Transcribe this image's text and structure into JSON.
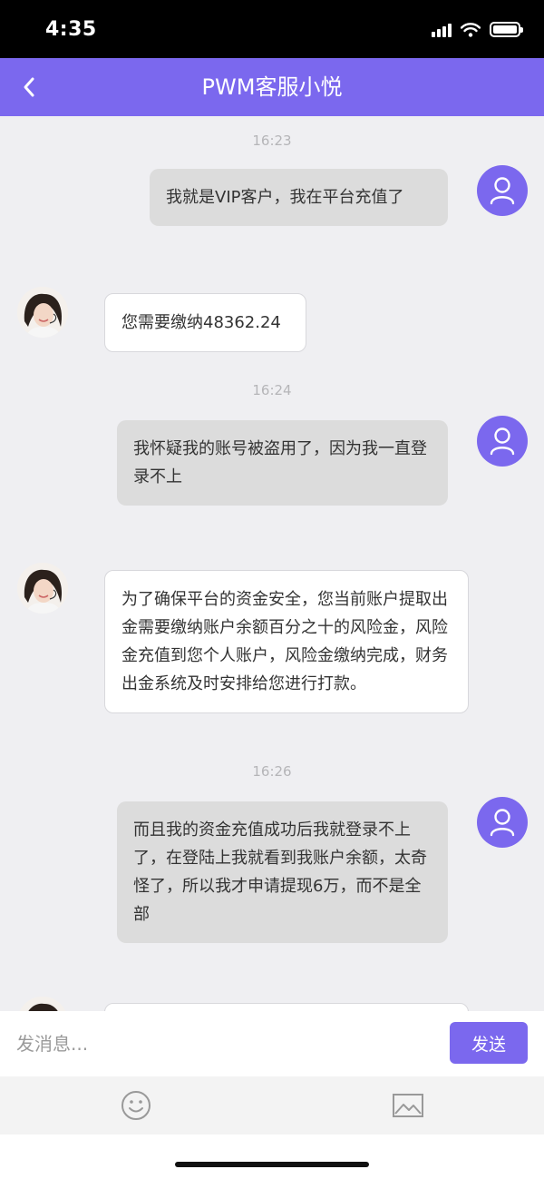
{
  "status_bar": {
    "time": "4:35"
  },
  "header": {
    "title": "PWM客服小悦"
  },
  "messages": [
    {
      "time": "16:23",
      "sender": "user",
      "text": "我就是VIP客户，我在平台充值了"
    },
    {
      "sender": "agent",
      "text": "您需要缴纳48362.24"
    },
    {
      "time": "16:24",
      "sender": "user",
      "text": "我怀疑我的账号被盗用了，因为我一直登录不上"
    },
    {
      "sender": "agent",
      "text": "为了确保平台的资金安全，您当前账户提取出金需要缴纳账户余额百分之十的风险金，风险金充值到您个人账户，风险金缴纳完成，财务出金系统及时安排给您进行打款。"
    },
    {
      "time": "16:26",
      "sender": "user",
      "text": "而且我的资金充值成功后我就登录不上了，在登陆上我就看到我账户余额，太奇怪了，所以我才申请提现6万，而不是全部"
    }
  ],
  "composer": {
    "placeholder": "发消息...",
    "send_label": "发送"
  },
  "toolbar": {
    "items": [
      "emoji-icon",
      "image-icon"
    ]
  },
  "colors": {
    "accent": "#7b68ee",
    "user_bubble": "#dcdcdc",
    "agent_bubble": "#ffffff",
    "background": "#efeff2"
  }
}
